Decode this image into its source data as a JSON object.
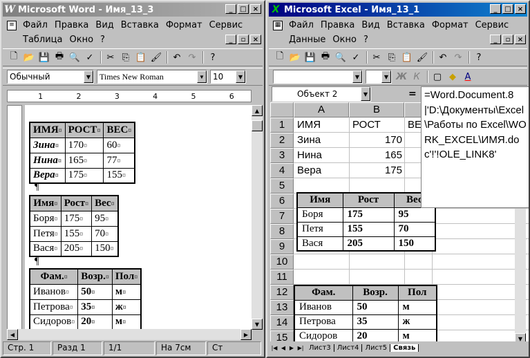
{
  "word": {
    "title": "Microsoft Word - Имя_13_3",
    "menu_row1": [
      "Файл",
      "Правка",
      "Вид",
      "Вставка",
      "Формат",
      "Сервис"
    ],
    "menu_row2": [
      "Таблица",
      "Окно",
      "?"
    ],
    "style_combo": "Обычный",
    "font_combo": "Times New Roman",
    "size_combo": "10",
    "ruler_marks": [
      "1",
      "2",
      "3",
      "4",
      "5",
      "6"
    ],
    "table1": {
      "headers": [
        "ИМЯ",
        "РОСТ",
        "ВЕС"
      ],
      "rows": [
        [
          "Зина",
          "170",
          "60"
        ],
        [
          "Нина",
          "165",
          "77"
        ],
        [
          "Вера",
          "175",
          "155"
        ]
      ]
    },
    "table2": {
      "headers": [
        "Имя",
        "Рост",
        "Вес"
      ],
      "rows": [
        [
          "Боря",
          "175",
          "95"
        ],
        [
          "Петя",
          "155",
          "70"
        ],
        [
          "Вася",
          "205",
          "150"
        ]
      ]
    },
    "table3": {
      "headers": [
        "Фам.",
        "Возр.",
        "Пол"
      ],
      "rows": [
        [
          "Иванов",
          "50",
          "м"
        ],
        [
          "Петрова",
          "35",
          "ж"
        ],
        [
          "Сидоров",
          "20",
          "м"
        ]
      ]
    },
    "cell_mark": "¤",
    "para_mark": "¶",
    "status": {
      "page": "Стр. 1",
      "section": "Разд 1",
      "pages": "1/1",
      "at": "На 7см",
      "line": "Ст"
    }
  },
  "excel": {
    "title": "Microsoft Excel - Имя_13_1",
    "menu_row1": [
      "Файл",
      "Правка",
      "Вид",
      "Вставка",
      "Формат",
      "Сервис"
    ],
    "menu_row2": [
      "Данные",
      "Окно",
      "?"
    ],
    "name_box": "Объект 2",
    "equals": "=",
    "formula": "=Word.Document.8|'D:\\Документы\\Excel\\Работы по Excel\\WORK_EXCEL\\ИМЯ.doc'!'!OLE_LINK8'",
    "col_headers": [
      "A",
      "B"
    ],
    "row_headers": [
      "1",
      "2",
      "3",
      "4",
      "5",
      "6",
      "7",
      "8",
      "9",
      "10",
      "11",
      "12",
      "13",
      "14",
      "15"
    ],
    "cells": [
      [
        "ИМЯ",
        "РОСТ",
        "ВЕ"
      ],
      [
        "Зина",
        "170",
        ""
      ],
      [
        "Нина",
        "165",
        ""
      ],
      [
        "Вера",
        "175",
        ""
      ]
    ],
    "table2": {
      "headers": [
        "Имя",
        "Рост",
        "Вес"
      ],
      "rows": [
        [
          "Боря",
          "175",
          "95"
        ],
        [
          "Петя",
          "155",
          "70"
        ],
        [
          "Вася",
          "205",
          "150"
        ]
      ]
    },
    "table3": {
      "headers": [
        "Фам.",
        "Возр.",
        "Пол"
      ],
      "rows": [
        [
          "Иванов",
          "50",
          "м"
        ],
        [
          "Петрова",
          "35",
          "ж"
        ],
        [
          "Сидоров",
          "20",
          "м"
        ]
      ]
    },
    "sheet_tabs": [
      "Лист3",
      "Лист4",
      "Лист5",
      "Связь"
    ],
    "active_sheet": "Связь"
  }
}
